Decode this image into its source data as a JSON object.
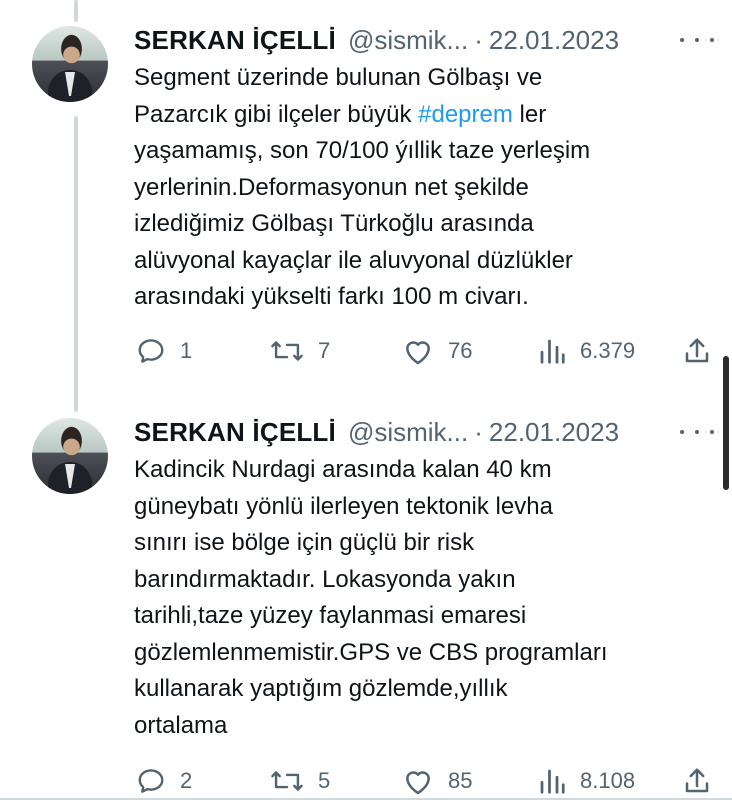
{
  "tweets": [
    {
      "author_name": "SERKAN İÇELLİ",
      "handle": "@sismik...",
      "separator": "·",
      "date": "22.01.2023",
      "text_before_hashtag": "Segment üzerinde bulunan Gölbaşı ve\nPazarcık gibi ilçeler büyük ",
      "hashtag": "#deprem",
      "text_after_hashtag": " ler\nyaşamamış, son 70/100 ýıllik taze yerleşim\nyerlerinin.Deformasyonun net şekilde\nizlediğimiz Gölbaşı Türkoğlu arasında\nalüvyonal kayaçlar ile aluvyonal düzlükler\narasındaki yükselti farkı 100 m civarı.",
      "replies": "1",
      "retweets": "7",
      "likes": "76",
      "views": "6.379"
    },
    {
      "author_name": "SERKAN İÇELLİ",
      "handle": "@sismik...",
      "separator": "·",
      "date": "22.01.2023",
      "text": "Kadincik Nurdagi arasında kalan 40 km\ngüneybatı yönlü ilerleyen tektonik levha\nsınırı ise bölge için güçlü bir risk\nbarındırmaktadır. Lokasyonda yakın\ntarihli,taze yüzey faylanmasi emaresi\ngözlemlenmemistir.GPS ve CBS programları\nkullanarak yaptığım gözlemde,yıllık\nortalama",
      "replies": "2",
      "retweets": "5",
      "likes": "85",
      "views": "8.108"
    }
  ],
  "icons": {
    "reply": "reply-icon",
    "retweet": "retweet-icon",
    "like": "heart-icon",
    "views": "views-icon",
    "share": "share-icon",
    "more": "more-icon"
  },
  "colors": {
    "text": "#0f1419",
    "secondary": "#536471",
    "hashtag": "#1d9bf0",
    "thread_line": "#cfd9de"
  }
}
